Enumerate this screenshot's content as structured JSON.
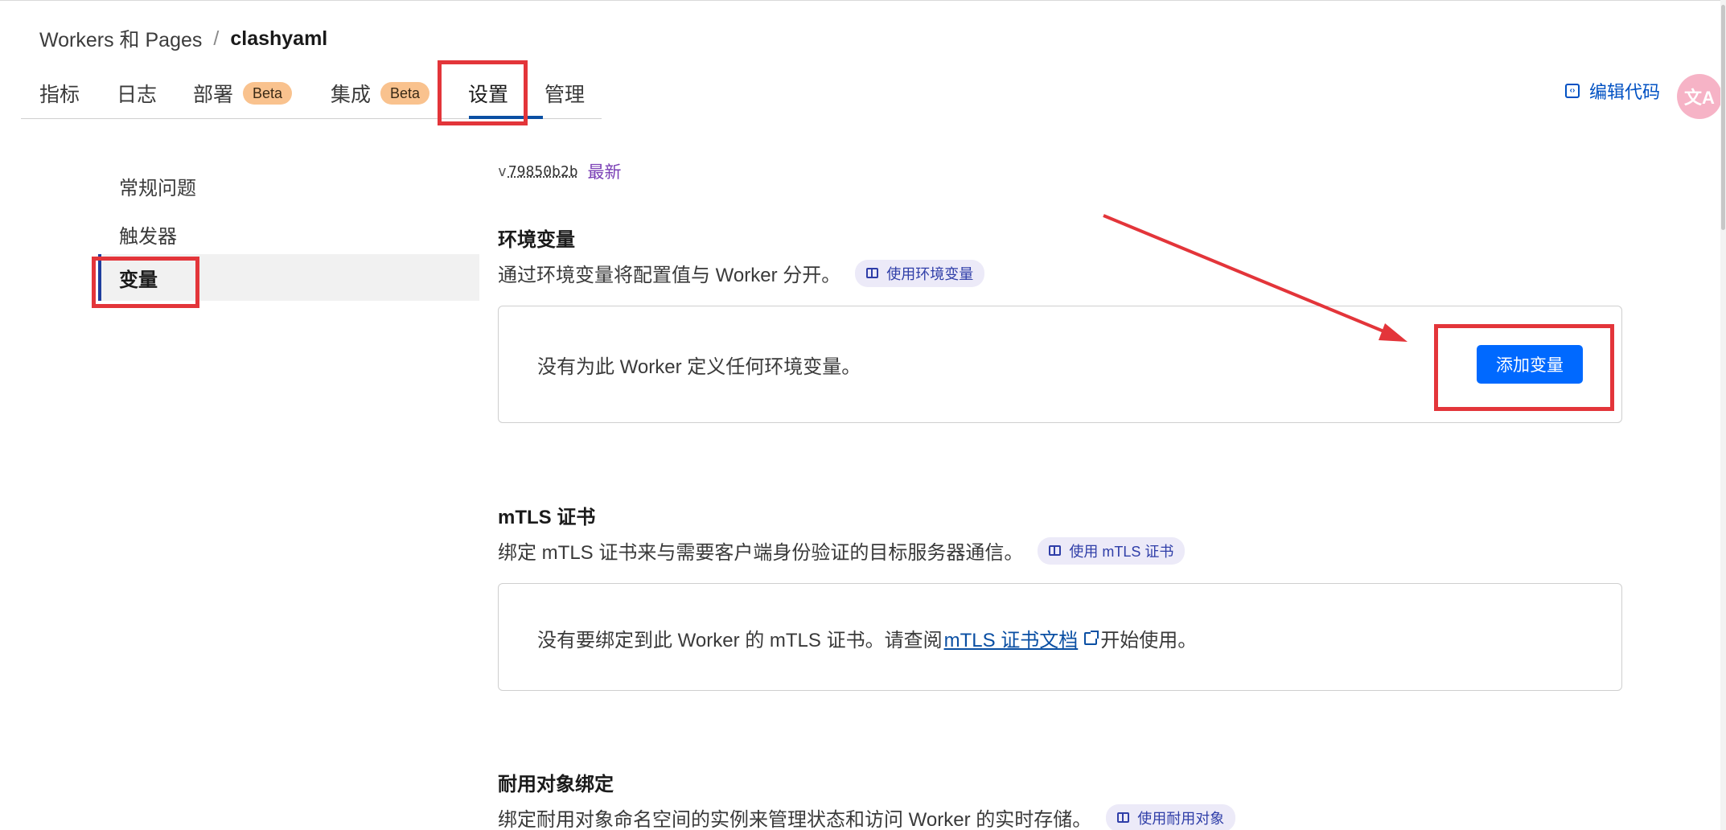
{
  "breadcrumb": {
    "parent": "Workers 和 Pages",
    "separator": "/",
    "current": "clashyaml"
  },
  "tabs": [
    {
      "label": "指标",
      "badge": ""
    },
    {
      "label": "日志",
      "badge": ""
    },
    {
      "label": "部署",
      "badge": "Beta"
    },
    {
      "label": "集成",
      "badge": "Beta"
    },
    {
      "label": "设置",
      "badge": ""
    },
    {
      "label": "管理",
      "badge": ""
    }
  ],
  "header_actions": {
    "edit_code": "编辑代码",
    "translate_icon": "translate-icon"
  },
  "side_nav": [
    {
      "label": "常规问题"
    },
    {
      "label": "触发器"
    },
    {
      "label": "变量"
    }
  ],
  "version": {
    "prefix": "v",
    "hash": "79850b2b",
    "status": "最新"
  },
  "sections": {
    "env": {
      "title": "环境变量",
      "description": "通过环境变量将配置值与 Worker 分开。",
      "doc_link": "使用环境变量",
      "empty_text": "没有为此 Worker 定义任何环境变量。",
      "add_button": "添加变量"
    },
    "mtls": {
      "title": "mTLS 证书",
      "description": "绑定 mTLS 证书来与需要客户端身份验证的目标服务器通信。",
      "doc_link": "使用 mTLS 证书",
      "empty_prefix": "没有要绑定到此 Worker 的 mTLS 证书。请查阅",
      "empty_link": "mTLS 证书文档",
      "empty_suffix": "开始使用。"
    },
    "durable": {
      "title": "耐用对象绑定",
      "description": "绑定耐用对象命名空间的实例来管理状态和访问 Worker 的实时存储。",
      "doc_link": "使用耐用对象"
    }
  },
  "colors": {
    "primary": "#0069ff",
    "link": "#0a4fa3",
    "badge": "#f9c28e",
    "annotation": "#e3353a",
    "version_latest": "#7a3fb5"
  }
}
